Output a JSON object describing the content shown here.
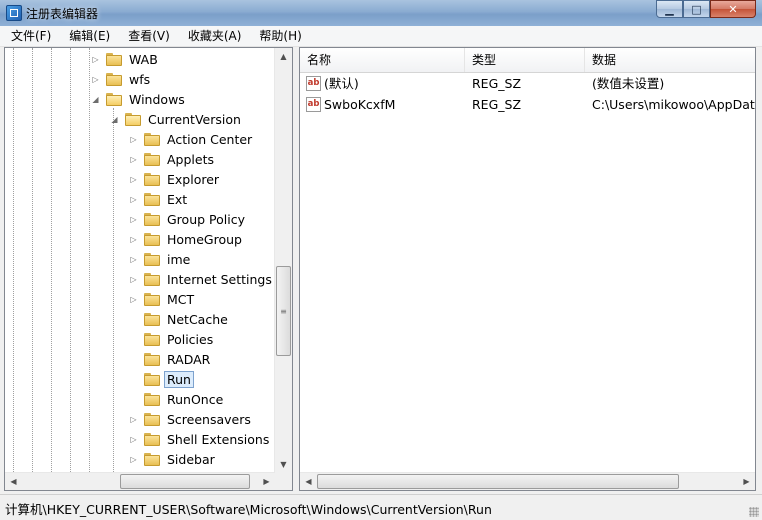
{
  "window": {
    "title": "注册表编辑器",
    "buttons": {
      "minimize": "▁",
      "maximize": "□",
      "close": "✕"
    }
  },
  "menubar": [
    "文件(F)",
    "编辑(E)",
    "查看(V)",
    "收藏夹(A)",
    "帮助(H)"
  ],
  "tree": {
    "items": [
      {
        "label": "WAB",
        "expander": "▷"
      },
      {
        "label": "wfs",
        "expander": "▷"
      },
      {
        "label": "Windows",
        "expander": "◢"
      },
      {
        "label": "CurrentVersion",
        "expander": "◢"
      },
      {
        "label": "Action Center",
        "expander": "▷"
      },
      {
        "label": "Applets",
        "expander": "▷"
      },
      {
        "label": "Explorer",
        "expander": "▷"
      },
      {
        "label": "Ext",
        "expander": "▷"
      },
      {
        "label": "Group Policy",
        "expander": "▷"
      },
      {
        "label": "HomeGroup",
        "expander": "▷"
      },
      {
        "label": "ime",
        "expander": "▷"
      },
      {
        "label": "Internet Settings",
        "expander": "▷"
      },
      {
        "label": "MCT",
        "expander": "▷"
      },
      {
        "label": "NetCache",
        "expander": ""
      },
      {
        "label": "Policies",
        "expander": ""
      },
      {
        "label": "RADAR",
        "expander": ""
      },
      {
        "label": "Run",
        "expander": "",
        "selected": true
      },
      {
        "label": "RunOnce",
        "expander": ""
      },
      {
        "label": "Screensavers",
        "expander": "▷"
      },
      {
        "label": "Shell Extensions",
        "expander": "▷"
      },
      {
        "label": "Sidebar",
        "expander": "▷"
      }
    ]
  },
  "list": {
    "columns": [
      "名称",
      "类型",
      "数据"
    ],
    "rows": [
      {
        "icon": "ab",
        "name": "(默认)",
        "type": "REG_SZ",
        "data": "(数值未设置)"
      },
      {
        "icon": "ab",
        "name": "SwboKcxfM",
        "type": "REG_SZ",
        "data": "C:\\Users\\mikowoo\\AppData"
      }
    ]
  },
  "scroll": {
    "up": "▲",
    "down": "▼",
    "left": "◀",
    "right": "▶",
    "grip": "≡"
  },
  "statusbar": {
    "path": "计算机\\HKEY_CURRENT_USER\\Software\\Microsoft\\Windows\\CurrentVersion\\Run"
  }
}
